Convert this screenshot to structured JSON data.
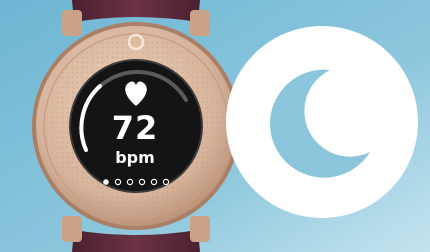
{
  "watch": {
    "heart_rate_value": "72",
    "heart_rate_unit": "bpm",
    "screen_icon": "heart-icon",
    "page_indicator": {
      "total": 6,
      "active": 1
    },
    "heart_rate_gauge_level": 0.55
  },
  "badge": {
    "icon": "crescent-moon-icon"
  },
  "colors": {
    "background": "#7cc0d8",
    "strap": "#5a2a3a",
    "bezel": "#d6b39a",
    "screen": "#141414",
    "badge": "#ffffff",
    "moon": "#8cc6dc"
  }
}
